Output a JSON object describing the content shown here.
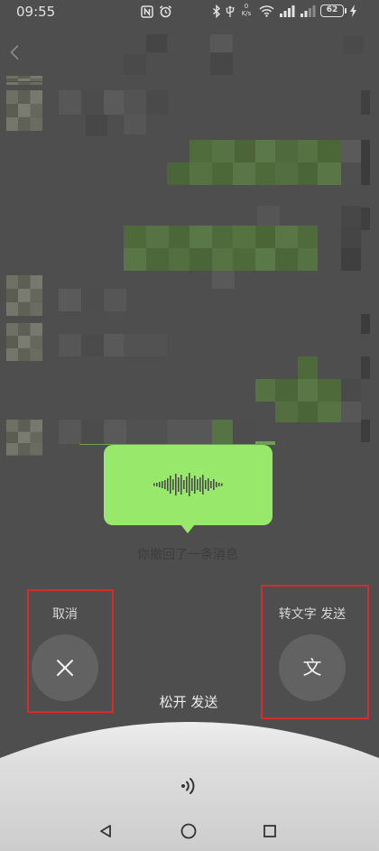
{
  "status_bar": {
    "time": "09:55",
    "net_speed_value": "0",
    "net_speed_unit": "K/s",
    "battery_level": "62",
    "icons": {
      "nfc": "nfc-icon",
      "alarm": "alarm-icon",
      "bluetooth": "bluetooth-icon",
      "usb": "usb-icon",
      "wifi": "wifi-icon",
      "signal_1": "signal-icon",
      "signal_2": "signal-icon",
      "charging": "charging-bolt-icon"
    }
  },
  "header": {
    "back_icon": "chevron-left-icon"
  },
  "chat": {
    "recalled_notice": "你撤回了一条消息"
  },
  "voice_overlay": {
    "waveform_icon": "waveform-icon",
    "cancel_label": "取消",
    "cancel_icon": "close-icon",
    "convert_label": "转文字 发送",
    "convert_icon_text": "文",
    "release_hint": "松开 发送",
    "speaker_icon": "sound-wave-icon"
  },
  "nav_bar": {
    "back": "nav-back-icon",
    "home": "nav-home-icon",
    "recents": "nav-recents-icon"
  },
  "colors": {
    "overlay_background": "#4e4e4e",
    "voice_bubble": "#98e86c",
    "button_circle": "#626262",
    "highlight_box": "#d42b2b",
    "bottom_panel": "#dcdcdc",
    "primary_text": "#e8e8e8"
  }
}
